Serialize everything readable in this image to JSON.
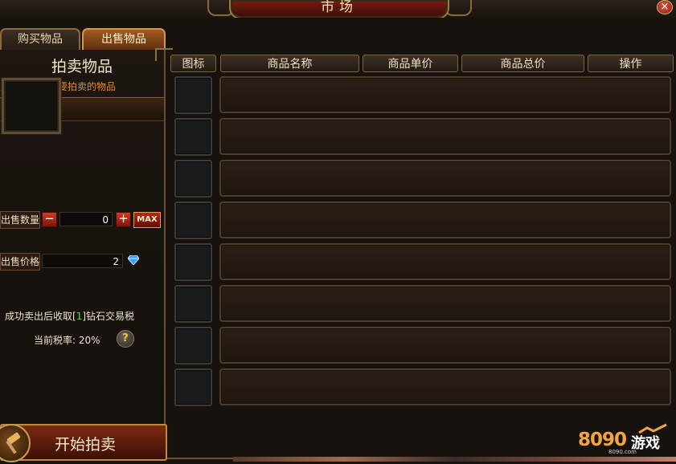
{
  "window": {
    "title": "市场",
    "close_label": "×"
  },
  "tabs": [
    {
      "label": "购买物品",
      "active": false
    },
    {
      "label": "出售物品",
      "active": true
    }
  ],
  "sell_panel": {
    "title": "拍卖物品",
    "hint": "点击此处放入要拍卖的物品",
    "quantity_label": "出售数量",
    "quantity_value": "0",
    "minus_label": "−",
    "plus_label": "+",
    "max_label": "MAX",
    "price_label": "出售价格",
    "price_value": "2",
    "price_currency_icon": "diamond-icon",
    "tax_prefix": "成功卖出后收取[",
    "tax_amount": "1",
    "tax_suffix": "]钻石交易税",
    "rate_text": "当前税率: 20%",
    "help_label": "?",
    "start_button_label": "开始拍卖"
  },
  "table": {
    "headers": [
      "图标",
      "商品名称",
      "商品单价",
      "商品总价",
      "操作"
    ],
    "rows": [
      {},
      {},
      {},
      {},
      {},
      {},
      {},
      {}
    ]
  },
  "logo": {
    "digits": "8090",
    "word": "游戏",
    "sub": "8090.com"
  },
  "colors": {
    "accent": "#a35a20",
    "hint": "#e58a2c",
    "tax_highlight": "#48e04a",
    "button_red": "#b8281a"
  }
}
